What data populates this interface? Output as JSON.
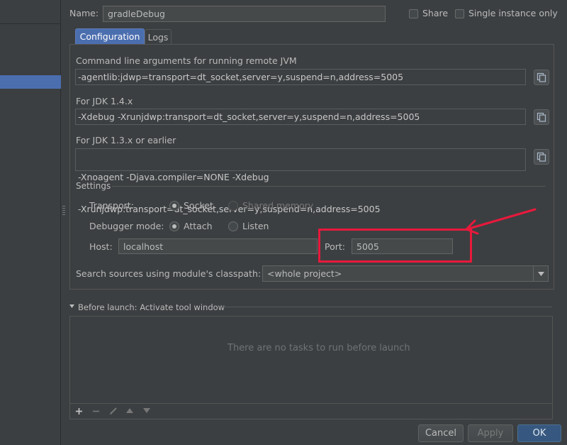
{
  "header": {
    "name_label": "Name:",
    "name_value": "gradleDebug",
    "share_label": "Share",
    "single_instance_label": "Single instance only"
  },
  "tabs": [
    {
      "label": "Configuration",
      "active": true
    },
    {
      "label": "Logs",
      "active": false
    }
  ],
  "remote_jvm": {
    "label": "Command line arguments for running remote JVM",
    "value": "-agentlib:jdwp=transport=dt_socket,server=y,suspend=n,address=5005"
  },
  "jdk14": {
    "label": "For JDK 1.4.x",
    "value": "-Xdebug -Xrunjdwp:transport=dt_socket,server=y,suspend=n,address=5005"
  },
  "jdk13": {
    "label": "For JDK 1.3.x or earlier",
    "line1": "-Xnoagent -Djava.compiler=NONE -Xdebug",
    "line2": "-Xrunjdwp:transport=dt_socket,server=y,suspend=n,address=5005"
  },
  "settings": {
    "title": "Settings",
    "transport_label": "Transport:",
    "transport_socket": "Socket",
    "transport_shared": "Shared memory",
    "debugger_label": "Debugger mode:",
    "debugger_attach": "Attach",
    "debugger_listen": "Listen",
    "host_label": "Host:",
    "host_value": "localhost",
    "port_label": "Port:",
    "port_value": "5005"
  },
  "classpath": {
    "label": "Search sources using module's classpath:",
    "value": "<whole project>"
  },
  "before_launch": {
    "title": "Before launch: Activate tool window",
    "empty_text": "There are no tasks to run before launch"
  },
  "footer": {
    "cancel": "Cancel",
    "apply": "Apply",
    "ok": "OK"
  },
  "colors": {
    "background": "#3c3f41",
    "selection": "#4b6eaf",
    "annotation": "#e8193c",
    "ok_button": "#365880"
  },
  "icons": {
    "copy": "copy-icon",
    "collapse": "triangle-down-icon",
    "add": "plus-icon",
    "remove": "minus-icon",
    "edit": "pencil-icon",
    "up": "arrow-up-icon",
    "down": "arrow-down-icon",
    "dropdown": "chevron-down-icon"
  }
}
